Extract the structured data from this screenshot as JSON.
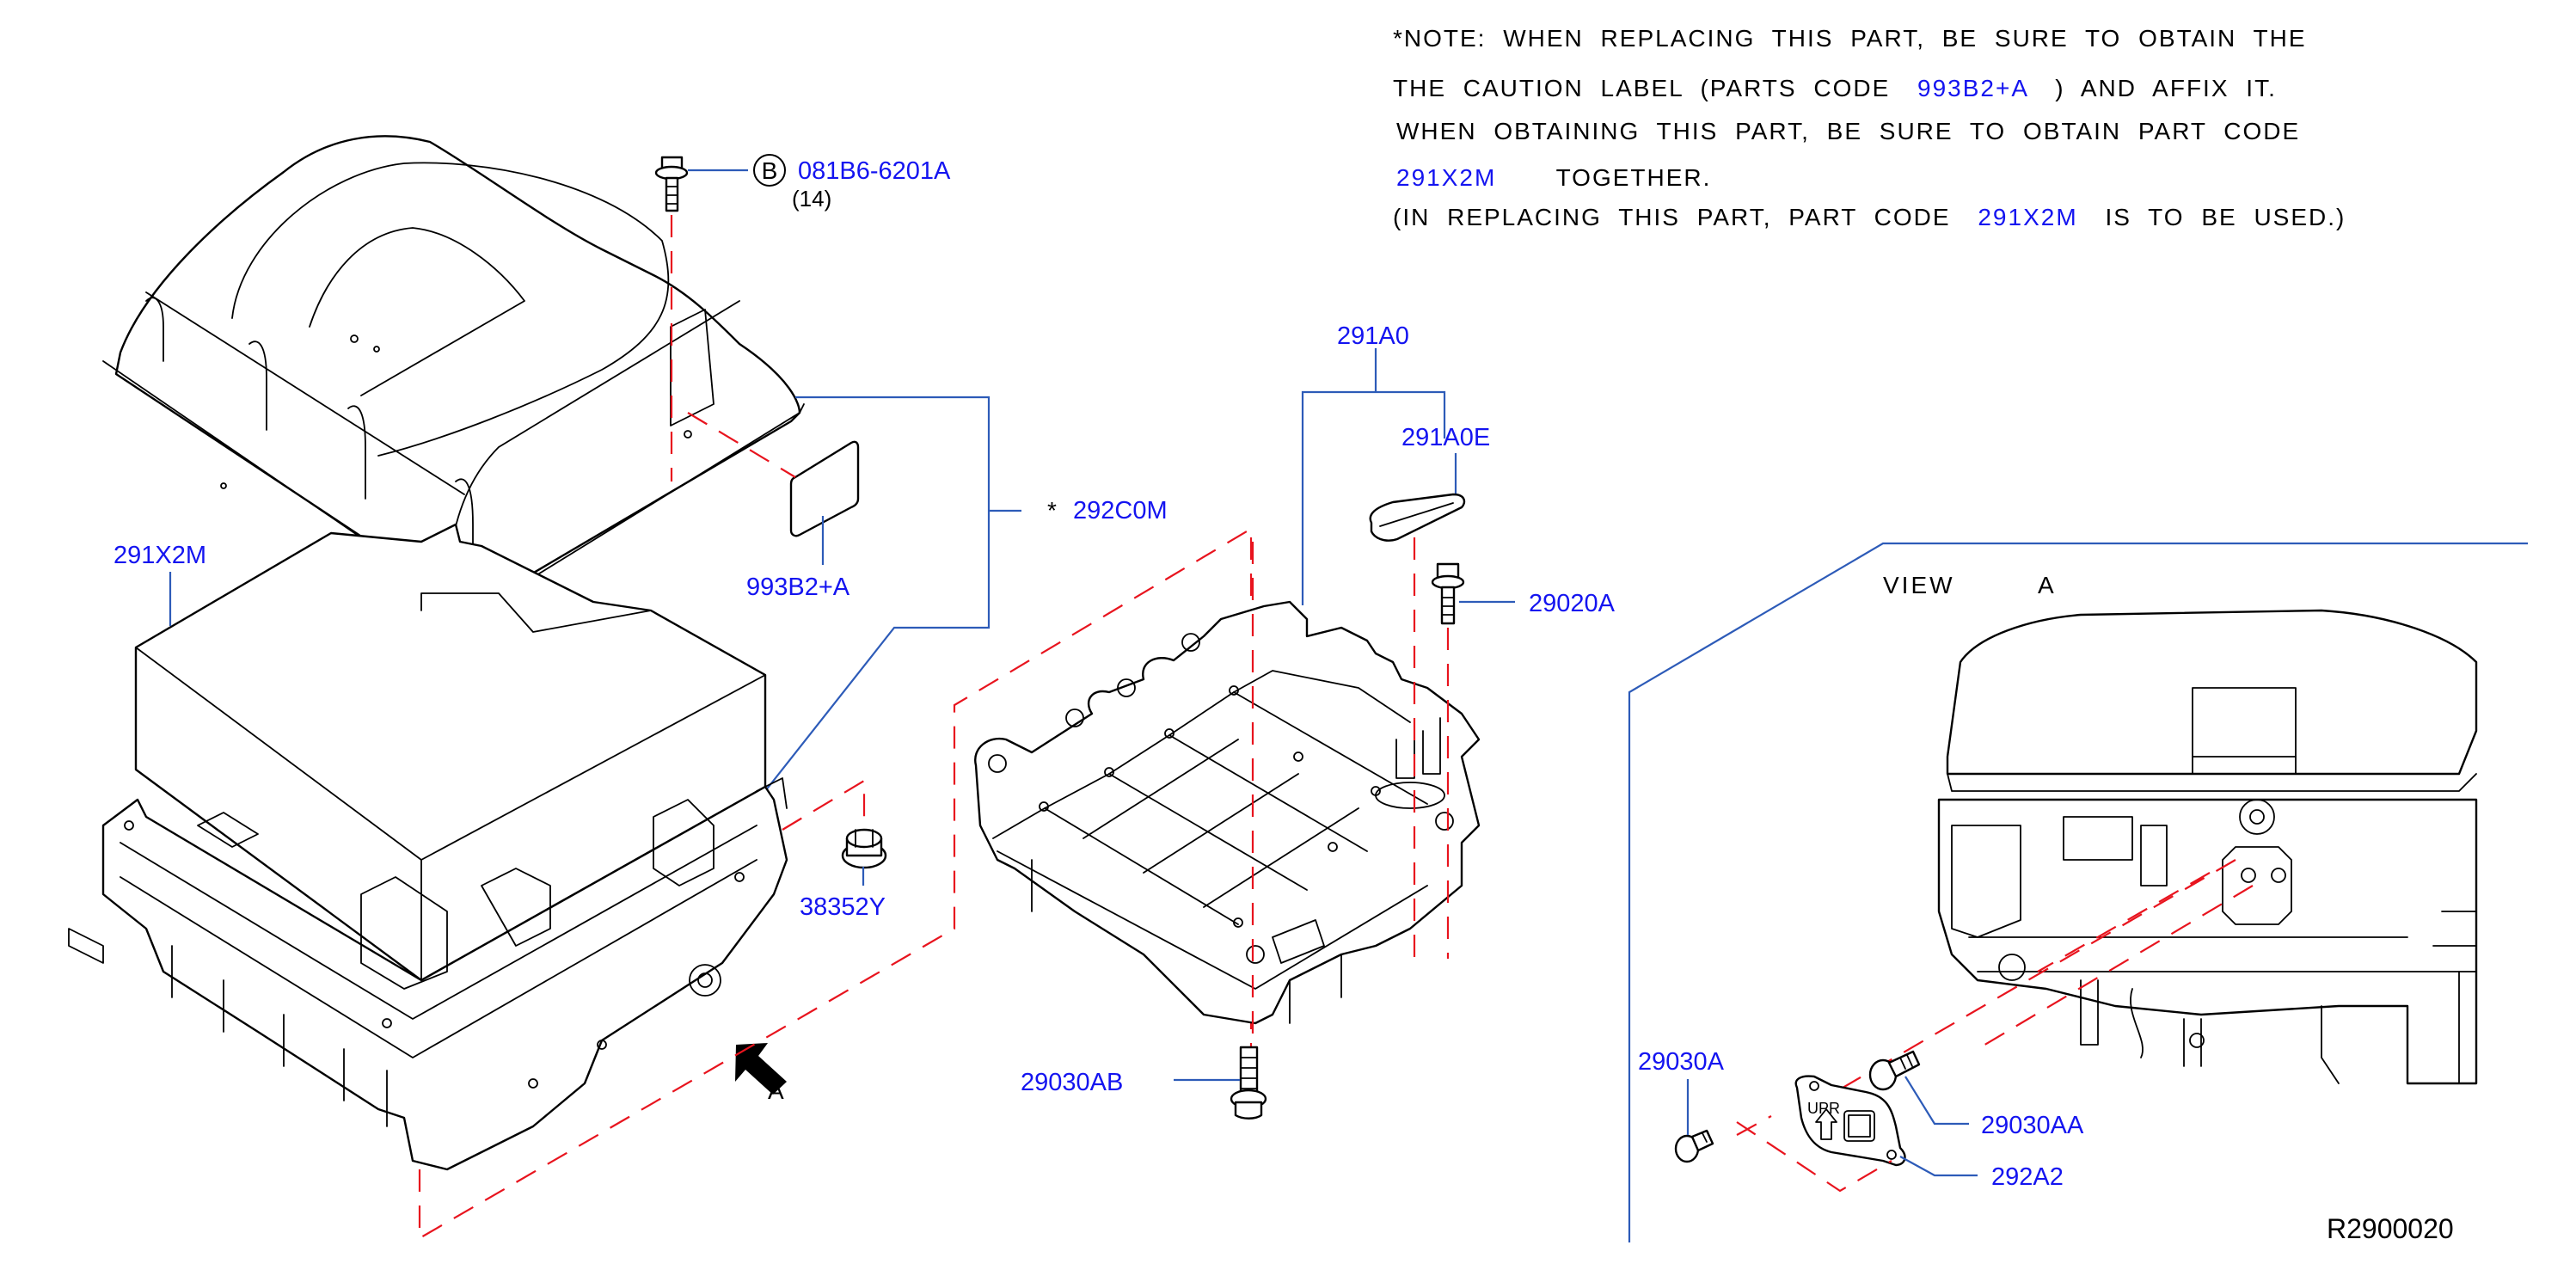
{
  "diagram": {
    "id": "R2900020",
    "note": {
      "line1": "*NOTE:  WHEN  REPLACING  THIS  PART,  BE  SURE  TO  OBTAIN  THE",
      "line2_pre": "THE  CAUTION  LABEL  (PARTS  CODE",
      "line2_code": "993B2+A",
      "line2_post": ")  AND  AFFIX  IT.",
      "line3": "WHEN  OBTAINING  THIS  PART,  BE  SURE  TO  OBTAIN  PART  CODE",
      "line4_code": "291X2M",
      "line4_post": "TOGETHER.",
      "line5_pre": "(IN  REPLACING  THIS  PART,  PART  CODE",
      "line5_code": "291X2M",
      "line5_post": "IS  TO  BE  USED.)"
    },
    "parts": [
      {
        "code": "081B6-6201A",
        "badge": "B",
        "qty": "(14)"
      },
      {
        "code": "291X2M"
      },
      {
        "code": "993B2+A"
      },
      {
        "code": "292C0M",
        "marker": "*"
      },
      {
        "code": "38352Y"
      },
      {
        "code": "291A0"
      },
      {
        "code": "291A0E"
      },
      {
        "code": "29020A"
      },
      {
        "code": "29030AB"
      },
      {
        "code": "29030A"
      },
      {
        "code": "29030AA"
      },
      {
        "code": "292A2"
      }
    ],
    "view_arrow_label": "A",
    "view_title": "VIEW",
    "view_letter": "A",
    "cover_text": "UPR",
    "colors": {
      "part_code": "#1414f0",
      "leader": "#2d5bb8",
      "dash": "#e8141e",
      "line": "#000000"
    }
  }
}
